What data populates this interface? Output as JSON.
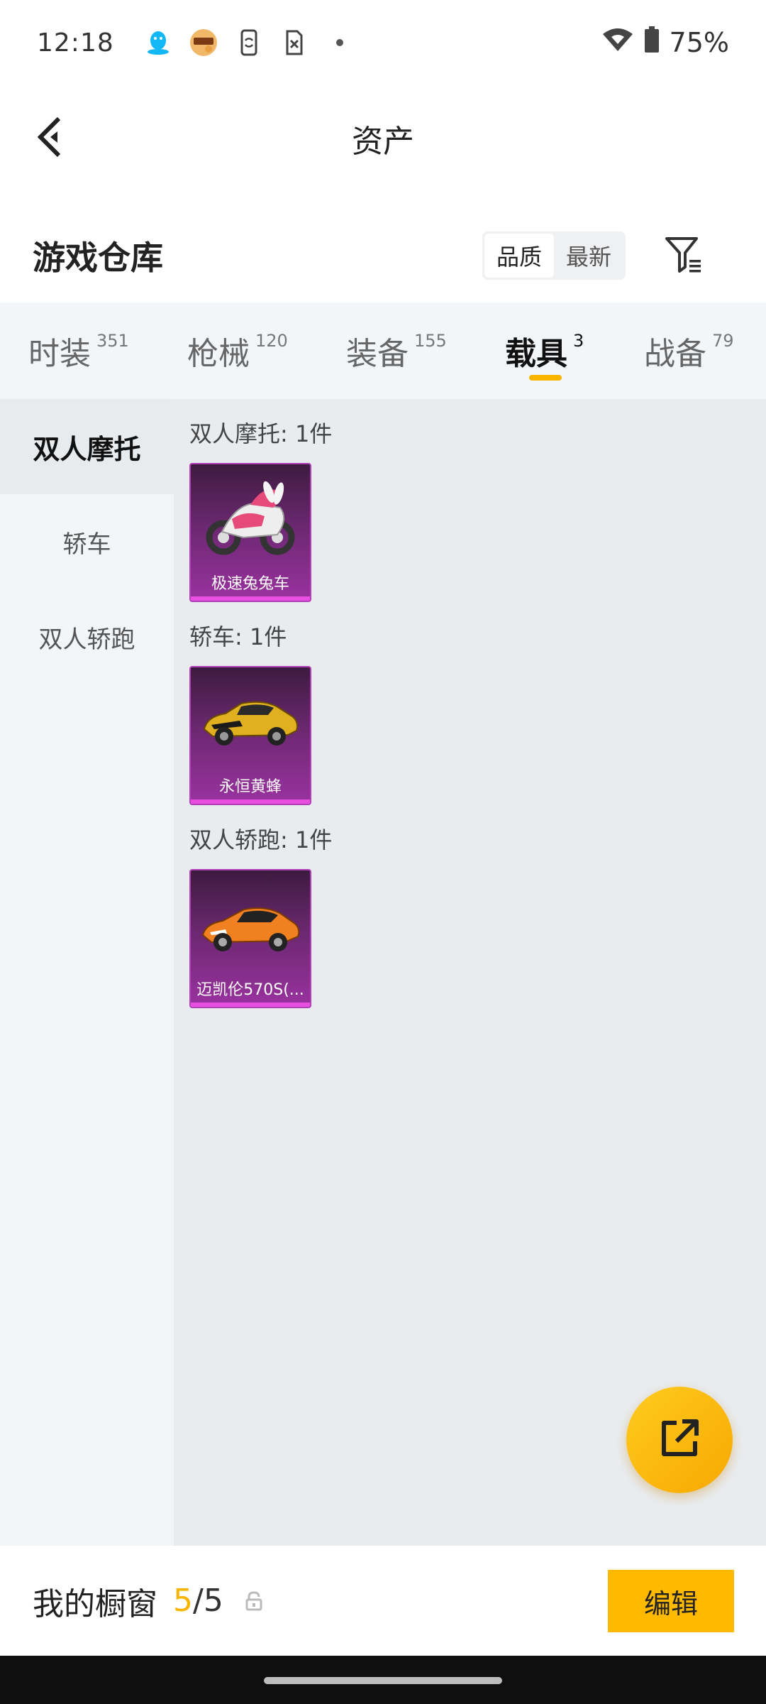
{
  "status_bar": {
    "time": "12:18",
    "battery": "75%",
    "icons": [
      "qq-icon",
      "game-app-icon",
      "screen-rotate-icon",
      "no-sim-icon",
      "dot-icon",
      "wifi-icon",
      "battery-icon"
    ]
  },
  "header": {
    "title": "资产",
    "back_icon": "chevron-left-icon"
  },
  "warehouse": {
    "title": "游戏仓库",
    "sort_options": [
      "品质",
      "最新"
    ],
    "sort_selected": "品质",
    "filter_icon": "filter-icon"
  },
  "tabs": [
    {
      "label": "时装",
      "count": "351"
    },
    {
      "label": "枪械",
      "count": "120"
    },
    {
      "label": "装备",
      "count": "155"
    },
    {
      "label": "载具",
      "count": "3",
      "active": true
    },
    {
      "label": "战备",
      "count": "79"
    }
  ],
  "sidebar": {
    "items": [
      {
        "label": "双人摩托",
        "active": true
      },
      {
        "label": "轿车"
      },
      {
        "label": "双人轿跑"
      }
    ]
  },
  "groups": [
    {
      "title": "双人摩托: 1件",
      "items": [
        {
          "name": "极速兔兔车",
          "art": "motorcycle"
        }
      ]
    },
    {
      "title": "轿车: 1件",
      "items": [
        {
          "name": "永恒黄蜂",
          "art": "yellow-car"
        }
      ]
    },
    {
      "title": "双人轿跑: 1件",
      "items": [
        {
          "name": "迈凯伦570S(...",
          "art": "orange-car"
        }
      ]
    }
  ],
  "colors": {
    "accent": "#f7b500",
    "card_bg": "#6b2870",
    "card_border": "#b03fb8"
  },
  "fab": {
    "icon": "share-external-icon"
  },
  "bottom": {
    "label": "我的橱窗",
    "current": "5",
    "separator": "/",
    "max": "5",
    "lock_icon": "lock-icon",
    "edit_label": "编辑"
  }
}
